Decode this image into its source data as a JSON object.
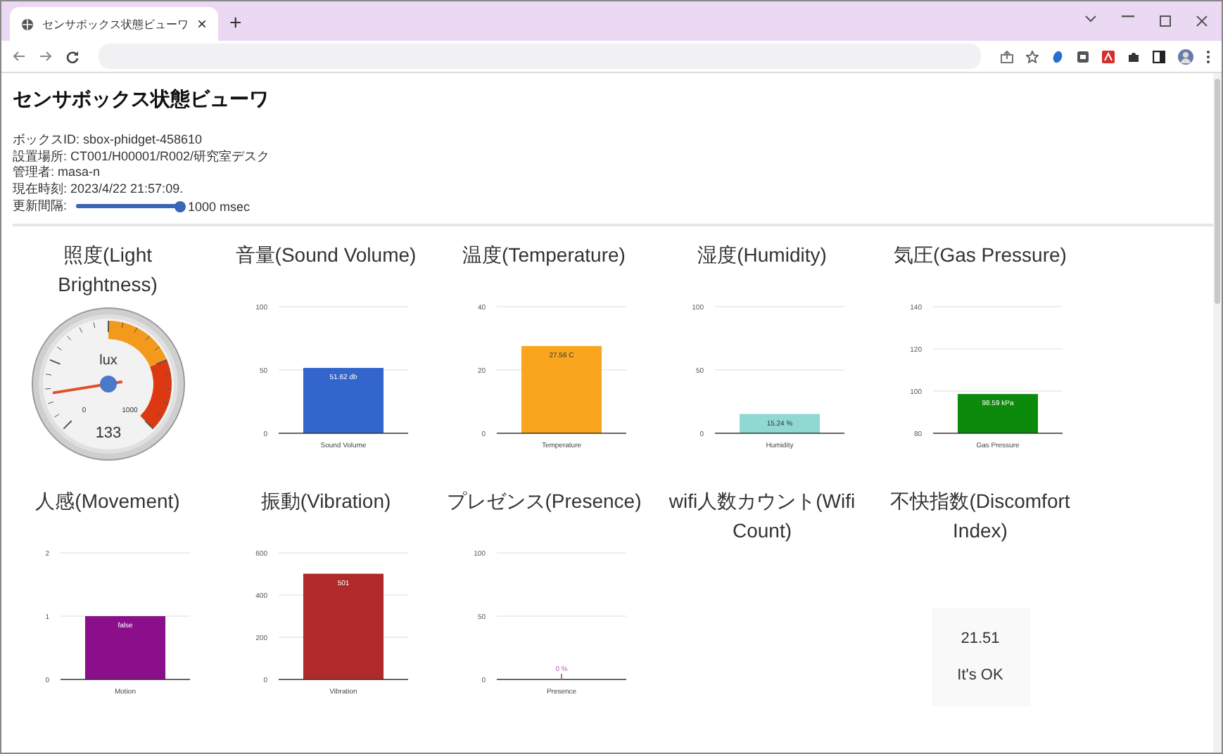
{
  "browser": {
    "tab": {
      "title": "センサボックス状態ビューワ",
      "close": "×"
    },
    "new_tab": "+"
  },
  "page": {
    "title": "センサボックス状態ビューワ",
    "info": [
      "ボックスID: sbox-phidget-458610",
      "設置場所: CT001/H00001/R002/研究室デスク",
      "管理者: masa-n",
      "現在時刻: 2023/4/22 21:57:09."
    ],
    "interval": {
      "label": "更新間隔:",
      "level": 1,
      "reading": "1000 msec"
    }
  },
  "panels": [
    {
      "kind": "gauge",
      "title": "照度(Light Brightness)",
      "gauge": {
        "unit": "lux",
        "min": "0",
        "max": "1000",
        "value": "133"
      }
    },
    {
      "kind": "chart",
      "title": "音量(Sound Volume)",
      "chart_data": {
        "type": "bar",
        "series": [
          {
            "name": "Sound Volume",
            "color": "#3366cc",
            "values": [
              51.62
            ]
          }
        ],
        "ylim": [
          0,
          100
        ],
        "yticks": [
          0,
          50,
          100
        ],
        "value_labels": [
          "51.62 db"
        ]
      }
    },
    {
      "kind": "chart",
      "title": "温度(Temperature)",
      "chart_data": {
        "type": "bar",
        "series": [
          {
            "name": "Temperature",
            "color": "#f9a61e",
            "values": [
              27.56
            ]
          }
        ],
        "ylim": [
          0,
          40
        ],
        "yticks": [
          0,
          20,
          40
        ],
        "value_labels": [
          "27.56 C"
        ]
      }
    },
    {
      "kind": "chart",
      "title": "湿度(Humidity)",
      "chart_data": {
        "type": "bar",
        "series": [
          {
            "name": "Humidity",
            "color": "#8fd9d2",
            "values": [
              15.24
            ]
          }
        ],
        "ylim": [
          0,
          100
        ],
        "yticks": [
          0,
          50,
          100
        ],
        "value_labels": [
          "15.24 %"
        ]
      }
    },
    {
      "kind": "chart",
      "title": "気圧(Gas Pressure)",
      "chart_data": {
        "type": "bar",
        "series": [
          {
            "name": "Gas Pressure",
            "color": "#0b8a0b",
            "values": [
              98.59
            ]
          }
        ],
        "ylim": [
          80,
          140
        ],
        "yticks": [
          80,
          100,
          120,
          140
        ],
        "value_labels": [
          "98.59 kPa"
        ]
      }
    },
    {
      "kind": "chart",
      "title": "人感(Movement)",
      "chart_data": {
        "type": "bar",
        "series": [
          {
            "name": "Motion",
            "color": "#8b0f8b",
            "values": [
              1
            ]
          }
        ],
        "ylim": [
          0,
          2
        ],
        "yticks": [
          0,
          1,
          2
        ],
        "value_labels": [
          "false"
        ]
      }
    },
    {
      "kind": "chart",
      "title": "振動(Vibration)",
      "chart_data": {
        "type": "bar",
        "series": [
          {
            "name": "Vibration",
            "color": "#b02a2a",
            "values": [
              501
            ]
          }
        ],
        "ylim": [
          0,
          600
        ],
        "yticks": [
          0,
          200,
          400,
          600
        ],
        "value_labels": [
          "501"
        ]
      }
    },
    {
      "kind": "chart",
      "title": "プレゼンス(Presence)",
      "chart_data": {
        "type": "bar",
        "series": [
          {
            "name": "Presence",
            "color": "#b06ab0",
            "values": [
              0
            ]
          }
        ],
        "ylim": [
          0,
          100
        ],
        "yticks": [
          0,
          50,
          100
        ],
        "value_labels": [
          "0 %"
        ]
      }
    },
    {
      "kind": "empty",
      "title": "wifi人数カウント(Wifi Count)"
    },
    {
      "kind": "index",
      "title": "不快指数(Discomfort Index)",
      "value": "21.51",
      "message": "It's OK"
    }
  ]
}
